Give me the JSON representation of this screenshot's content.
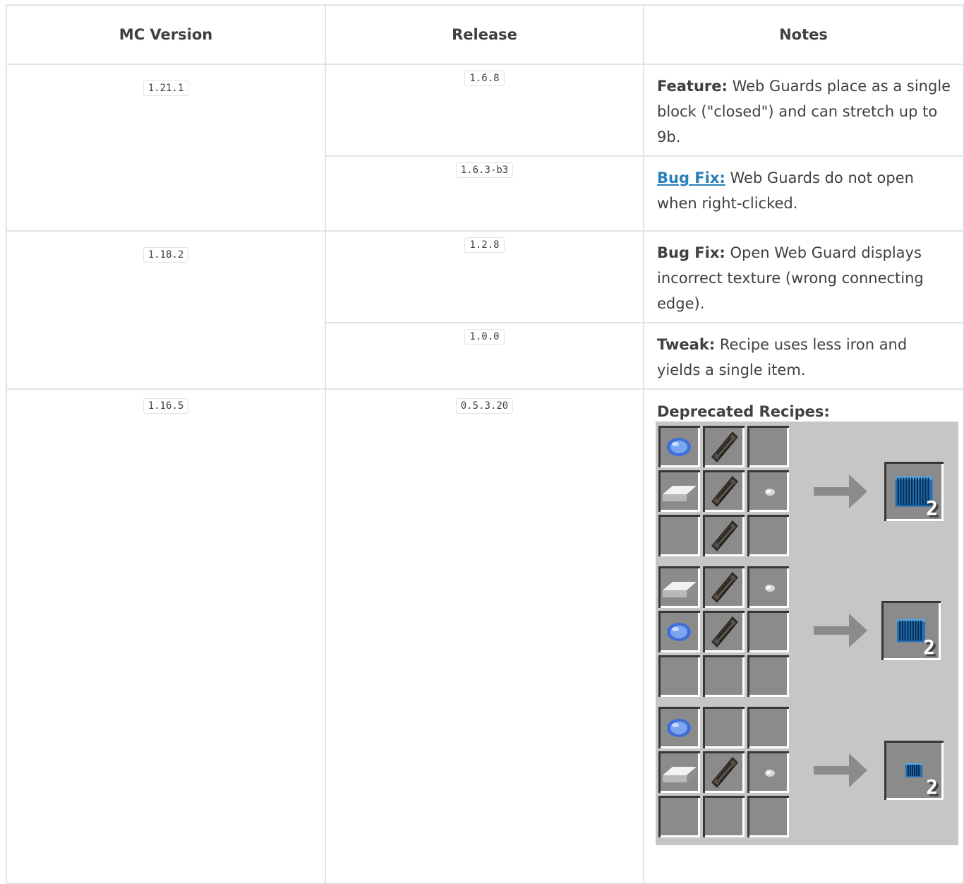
{
  "table": {
    "headers": [
      "MC Version",
      "Release",
      "Notes"
    ],
    "rows": [
      {
        "mc": "1.21.1",
        "release": "1.6.8",
        "label": "Feature:",
        "text": " Web Guards place as a single block (\"closed\") and can stretch up to 9b."
      },
      {
        "release": "1.6.3-b3",
        "label": "Bug Fix:",
        "text": " Web Guards do not open when right-clicked."
      },
      {
        "mc": "1.18.2",
        "release": "1.2.8",
        "label": "Bug Fix:",
        "text": " Open Web Guard displays incorrect texture (wrong connecting edge)."
      },
      {
        "release": "1.0.0",
        "label": "Tweak:",
        "text": " Recipe uses less iron and yields a single item."
      },
      {
        "mc": "1.16.5",
        "release": "0.5.3.20",
        "label": "Deprecated Recipes:"
      }
    ]
  },
  "recipes": [
    {
      "slots": [
        "blue-gem-icon",
        "leather-strap-icon",
        "",
        "iron-ingot-icon",
        "leather-strap-icon",
        "iron-nugget-icon",
        "",
        "leather-strap-icon",
        ""
      ],
      "output_icon": "web-guard-large-icon",
      "output_count": "2"
    },
    {
      "slots": [
        "iron-ingot-icon",
        "leather-strap-icon",
        "iron-nugget-icon",
        "blue-gem-icon",
        "leather-strap-icon",
        "",
        "",
        "",
        ""
      ],
      "output_icon": "web-guard-medium-icon",
      "output_count": "2"
    },
    {
      "slots": [
        "blue-gem-icon",
        "",
        "",
        "iron-ingot-icon",
        "leather-strap-icon",
        "iron-nugget-icon",
        "",
        "",
        ""
      ],
      "output_icon": "web-guard-small-icon",
      "output_count": "2"
    }
  ],
  "colors": {
    "link": "#2980b9",
    "text": "#404040",
    "border": "#e1e4e5",
    "panel": "#c6c6c6",
    "slot": "#8b8b8b"
  }
}
